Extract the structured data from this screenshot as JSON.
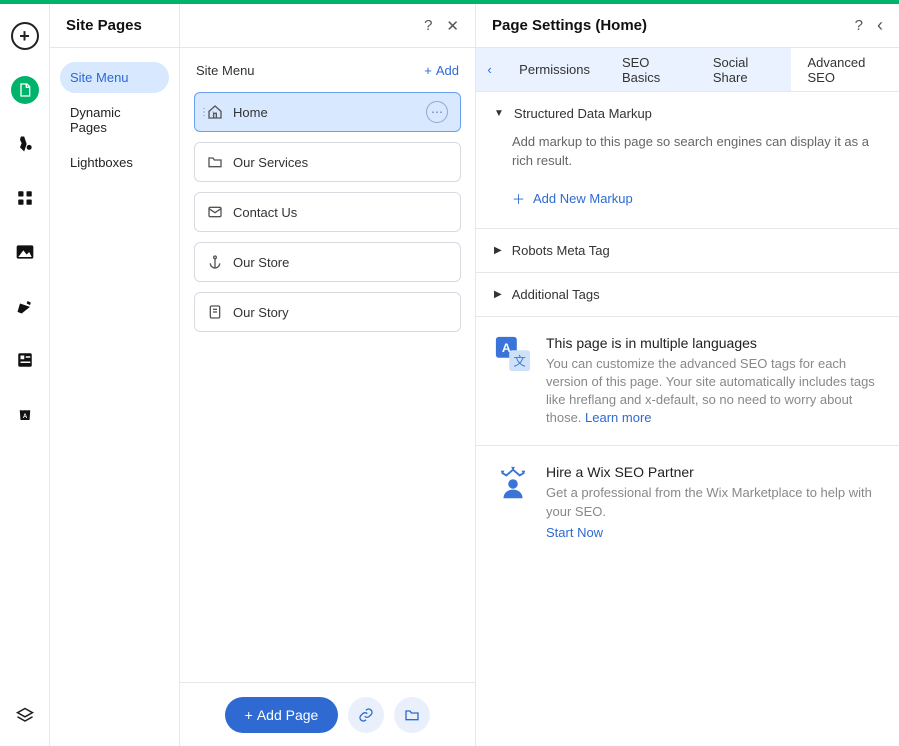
{
  "header_left": {
    "title": "Site Pages"
  },
  "header_right": {
    "title": "Page Settings (Home)"
  },
  "nav": {
    "items": [
      {
        "label": "Site Menu"
      },
      {
        "label": "Dynamic Pages"
      },
      {
        "label": "Lightboxes"
      }
    ]
  },
  "mid": {
    "title": "Site Menu",
    "add_label": "Add",
    "pages": [
      {
        "label": "Home"
      },
      {
        "label": "Our Services"
      },
      {
        "label": "Contact Us"
      },
      {
        "label": "Our Store"
      },
      {
        "label": "Our Story"
      }
    ],
    "add_page_label": "Add Page"
  },
  "tabs": {
    "items": [
      {
        "label": "Permissions"
      },
      {
        "label": "SEO Basics"
      },
      {
        "label": "Social Share"
      },
      {
        "label": "Advanced SEO"
      }
    ]
  },
  "sections": {
    "structured": {
      "title": "Structured Data Markup",
      "desc": "Add markup to this page so search engines can display it as a rich result.",
      "add_label": "Add New Markup"
    },
    "robots": {
      "title": "Robots Meta Tag"
    },
    "additional": {
      "title": "Additional Tags"
    }
  },
  "info": {
    "lang": {
      "title": "This page is in multiple languages",
      "text": "You can customize the advanced SEO tags for each version of this page. Your site automatically includes tags like hreflang and x-default, so no need to worry about those. ",
      "link": "Learn more"
    },
    "seo": {
      "title": "Hire a Wix SEO Partner",
      "text": "Get a professional from the Wix Marketplace to help with your SEO.",
      "link": "Start Now"
    }
  }
}
